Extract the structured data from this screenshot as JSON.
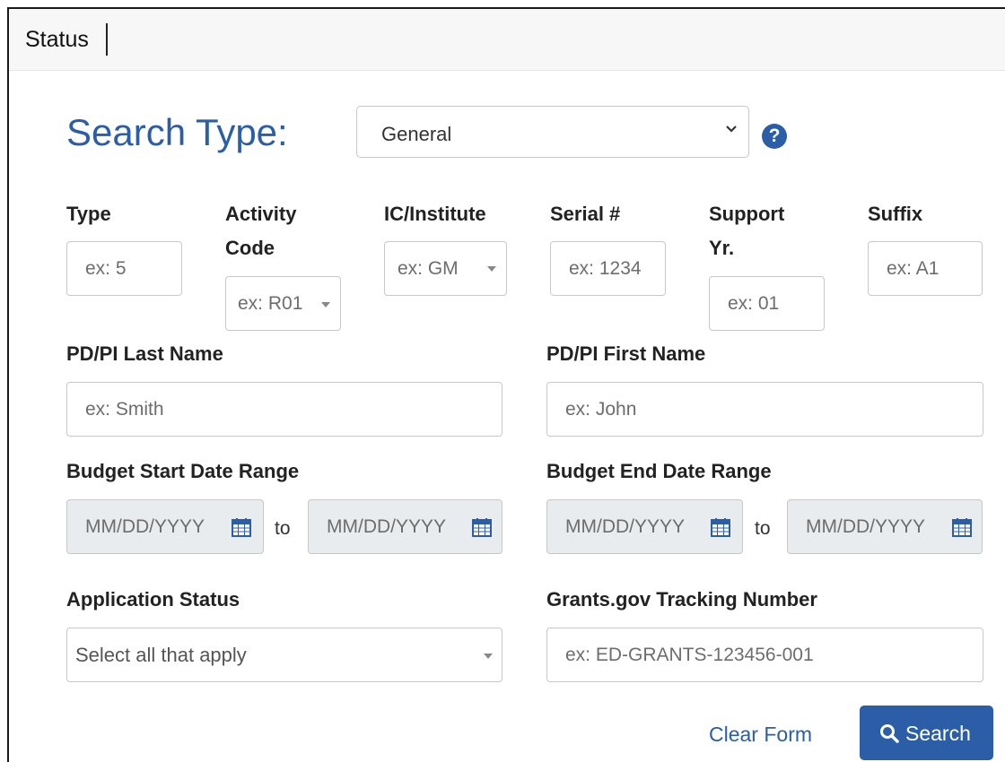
{
  "header": {
    "title": "Status"
  },
  "search_type": {
    "label": "Search Type:",
    "selected": "General",
    "help_icon": "question-circle-icon"
  },
  "fields": {
    "type": {
      "label": "Type",
      "placeholder": "ex: 5"
    },
    "activity_code": {
      "label_line1": "Activity",
      "label_line2": "Code",
      "placeholder": "ex: R01"
    },
    "ic_institute": {
      "label": "IC/Institute",
      "placeholder": "ex: GM"
    },
    "serial": {
      "label": "Serial #",
      "placeholder": "ex: 1234"
    },
    "support_yr": {
      "label_line1": "Support",
      "label_line2": "Yr.",
      "placeholder": "ex: 01"
    },
    "suffix": {
      "label": "Suffix",
      "placeholder": "ex: A1"
    },
    "pi_last": {
      "label": "PD/PI Last Name",
      "placeholder": "ex: Smith"
    },
    "pi_first": {
      "label": "PD/PI First Name",
      "placeholder": "ex: John"
    },
    "budget_start": {
      "label": "Budget Start Date Range",
      "from_placeholder": "MM/DD/YYYY",
      "to_placeholder": "MM/DD/YYYY",
      "to_text": "to"
    },
    "budget_end": {
      "label": "Budget End Date Range",
      "from_placeholder": "MM/DD/YYYY",
      "to_placeholder": "MM/DD/YYYY",
      "to_text": "to"
    },
    "app_status": {
      "label": "Application Status",
      "placeholder": "Select all that apply"
    },
    "tracking": {
      "label": "Grants.gov Tracking Number",
      "placeholder": "ex: ED-GRANTS-123456-001"
    }
  },
  "actions": {
    "clear": "Clear Form",
    "search": "Search"
  },
  "colors": {
    "accent": "#2b5ea7",
    "disabled_bg": "#e9ecef",
    "border": "#c8c8c8"
  }
}
